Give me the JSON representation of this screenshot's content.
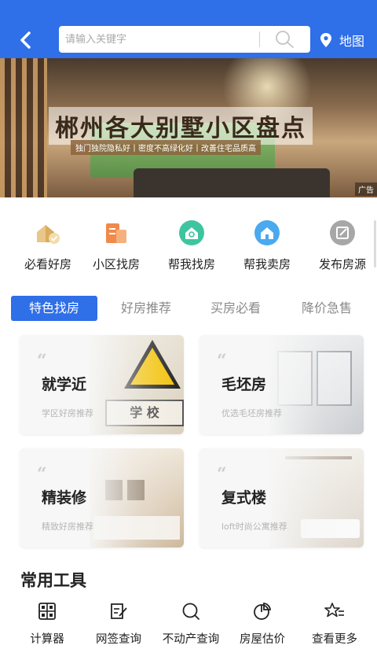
{
  "header": {
    "search_placeholder": "请输入关键字",
    "map_label": "地图",
    "bg_color": "#2f6fe8"
  },
  "banner": {
    "title": "郴州各大别墅小区盘点",
    "subtitle": "独门独院隐私好丨密度不高绿化好丨改善住宅品质高",
    "ad_label": "广告"
  },
  "categories": [
    {
      "label": "必看好房",
      "icon": "house-tag-icon"
    },
    {
      "label": "小区找房",
      "icon": "building-icon"
    },
    {
      "label": "帮我找房",
      "icon": "house-search-icon"
    },
    {
      "label": "帮我卖房",
      "icon": "house-sell-icon"
    },
    {
      "label": "发布房源",
      "icon": "publish-icon"
    }
  ],
  "tabs": [
    {
      "label": "特色找房",
      "active": true
    },
    {
      "label": "好房推荐",
      "active": false
    },
    {
      "label": "买房必看",
      "active": false
    },
    {
      "label": "降价急售",
      "active": false
    }
  ],
  "features": [
    {
      "title": "就学近",
      "desc": "学区好房推荐"
    },
    {
      "title": "毛坯房",
      "desc": "优选毛坯房推荐"
    },
    {
      "title": "精装修",
      "desc": "精致好房推荐"
    },
    {
      "title": "复式楼",
      "desc": "loft时尚公寓推荐"
    }
  ],
  "school_sign_text": "学 校",
  "tools": {
    "title": "常用工具",
    "items": [
      {
        "label": "计算器",
        "icon": "calculator-icon"
      },
      {
        "label": "网签查询",
        "icon": "contract-icon"
      },
      {
        "label": "不动产查询",
        "icon": "search-icon"
      },
      {
        "label": "房屋估价",
        "icon": "pie-chart-icon"
      },
      {
        "label": "查看更多",
        "icon": "star-list-icon"
      }
    ]
  }
}
